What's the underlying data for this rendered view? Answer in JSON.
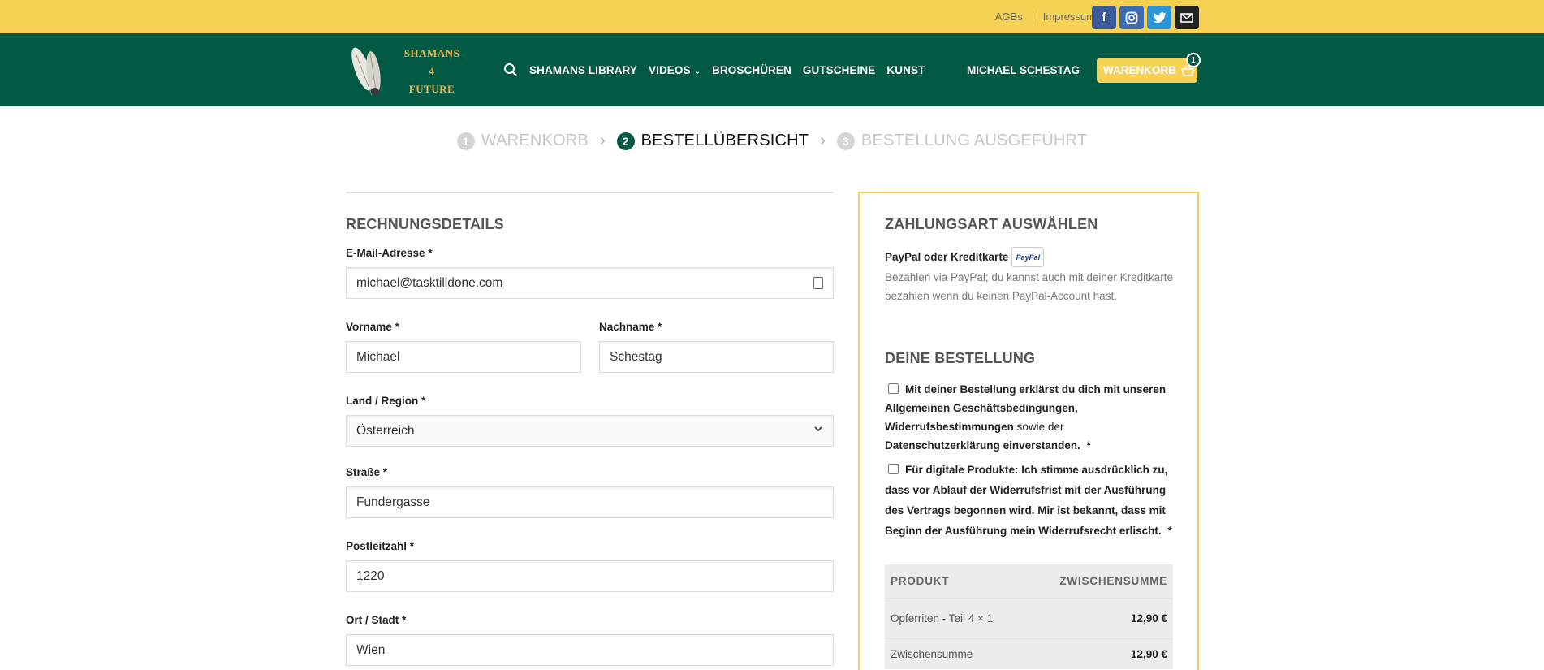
{
  "topbar": {
    "links": [
      "AGBs",
      "Impressum"
    ],
    "social_icons": [
      "facebook-icon",
      "instagram-icon",
      "twitter-icon",
      "email-icon"
    ],
    "color": "#f5d154"
  },
  "header": {
    "logo_lines": [
      "SHAMANS",
      "4",
      "FUTURE"
    ],
    "nav": [
      "SHAMANS LIBRARY",
      "VIDEOS",
      "BROSCHÜREN",
      "GUTSCHEINE",
      "KUNST"
    ],
    "user": "MICHAEL SCHESTAG",
    "cart_label": "WARENKORB",
    "cart_count": "1",
    "color": "#035a44"
  },
  "steps": [
    {
      "num": "1",
      "label": "WARENKORB",
      "state": "inactive"
    },
    {
      "num": "2",
      "label": "BESTELLÜBERSICHT",
      "state": "active"
    },
    {
      "num": "3",
      "label": "BESTELLUNG AUSGEFÜHRT",
      "state": "inactive"
    }
  ],
  "billing": {
    "title": "RECHNUNGSDETAILS",
    "email_label": "E-Mail-Adresse",
    "email_value": "michael@tasktilldone.com",
    "firstname_label": "Vorname",
    "firstname_value": "Michael",
    "lastname_label": "Nachname",
    "lastname_value": "Schestag",
    "country_label": "Land / Region",
    "country_value": "Österreich",
    "street_label": "Straße",
    "street_value": "Fundergasse",
    "zip_label": "Postleitzahl",
    "zip_value": "1220",
    "city_label": "Ort / Stadt",
    "city_value": "Wien",
    "required_mark": "*"
  },
  "payment": {
    "title": "ZAHLUNGSART AUSWÄHLEN",
    "method": "PayPal oder Kreditkarte",
    "badge": "PayPal",
    "description": "Bezahlen via PayPal; du kannst auch mit deiner Kreditkarte bezahlen wenn du keinen PayPal-Account hast."
  },
  "order": {
    "title": "DEINE BESTELLUNG",
    "terms_bold_1": "Mit deiner Bestellung erklärst du dich mit unseren Allgemeinen Geschäftsbedingungen, Widerrufsbestimmungen",
    "terms_plain": "sowie der",
    "terms_bold_2": "Datenschutzerklärung",
    "terms_plain_2": "einverstanden.",
    "digital": "Für digitale Produkte: Ich stimme ausdrücklich zu, dass vor Ablauf der Widerrufsfrist mit der Ausführung des Vertrags begonnen wird. Mir ist bekannt, dass mit Beginn der Ausführung mein Widerrufsrecht erlischt.",
    "star": "*",
    "col_product": "PRODUKT",
    "col_subtotal": "ZWISCHENSUMME",
    "item_name": "Opferriten - Teil 4  × 1",
    "item_price": "12,90 €",
    "subtotal_label": "Zwischensumme",
    "subtotal_value": "12,90 €"
  }
}
